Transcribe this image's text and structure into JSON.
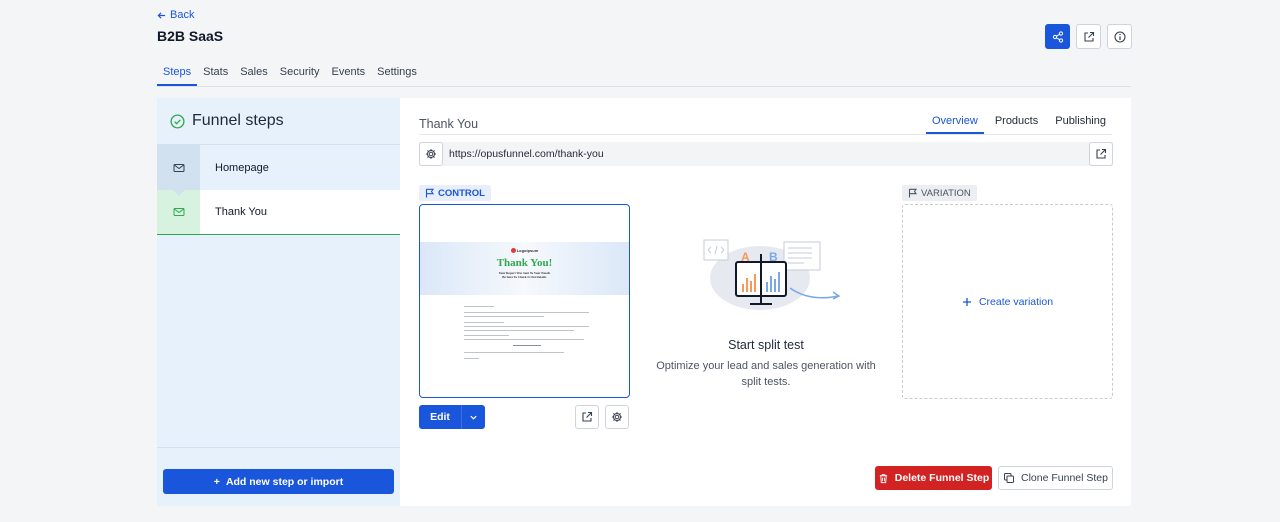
{
  "header": {
    "back_label": "Back",
    "title": "B2B SaaS",
    "actions": [
      {
        "icon": "share-icon"
      },
      {
        "icon": "external-link-icon"
      },
      {
        "icon": "info-icon"
      }
    ]
  },
  "tabs": [
    {
      "label": "Steps",
      "active": true
    },
    {
      "label": "Stats",
      "active": false
    },
    {
      "label": "Sales",
      "active": false
    },
    {
      "label": "Security",
      "active": false
    },
    {
      "label": "Events",
      "active": false
    },
    {
      "label": "Settings",
      "active": false
    }
  ],
  "sidebar": {
    "heading": "Funnel steps",
    "steps": [
      {
        "label": "Homepage",
        "icon": "mail-icon"
      },
      {
        "label": "Thank You",
        "icon": "mail-icon",
        "selected": true
      }
    ],
    "add_label": "Add new step or import"
  },
  "main": {
    "step_name": "Thank You",
    "sub_tabs": [
      {
        "label": "Overview",
        "active": true
      },
      {
        "label": "Products",
        "active": false
      },
      {
        "label": "Publishing",
        "active": false
      }
    ],
    "url": "https://opusfunnel.com/thank-you",
    "control_label": "CONTROL",
    "variation_label": "VARIATION",
    "preview": {
      "logo": "Logoipsum",
      "title": "Thank You!",
      "subtitle_1": "Your Report Was Sent To Your Email.",
      "subtitle_2": "Be Sure To Check It Out Details."
    },
    "edit_label": "Edit",
    "split_test": {
      "title": "Start split test",
      "desc_1": "Optimize your lead and sales generation with",
      "desc_2": "split tests."
    },
    "create_variation_label": "Create variation",
    "delete_label": "Delete Funnel Step",
    "clone_label": "Clone Funnel Step"
  },
  "colors": {
    "primary": "#1a56db",
    "danger": "#d32222",
    "success": "#2fa84f"
  }
}
